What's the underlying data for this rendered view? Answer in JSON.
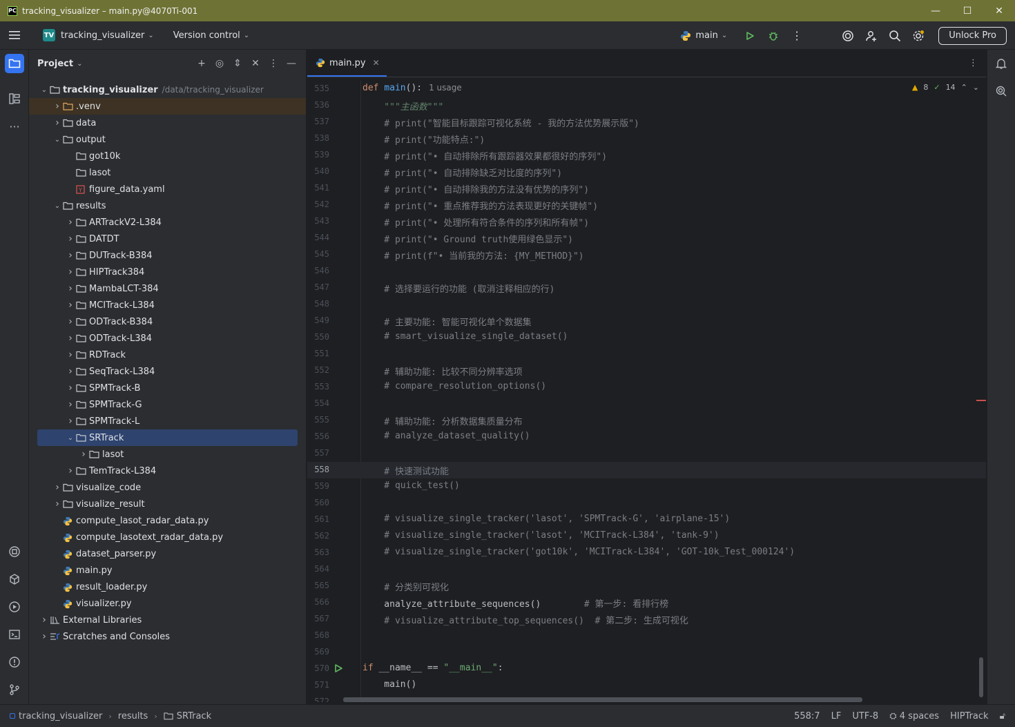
{
  "window": {
    "title": "tracking_visualizer – main.py@4070Ti-001",
    "minimize": "—",
    "maximize": "☐",
    "close": "✕"
  },
  "toolbar": {
    "project_badge": "TV",
    "project_name": "tracking_visualizer",
    "version_control": "Version control",
    "run_config": "main",
    "unlock": "Unlock Pro"
  },
  "project_panel": {
    "title": "Project",
    "tree": [
      {
        "label": "tracking_visualizer",
        "hint": "/data/tracking_visualizer",
        "level": 0,
        "type": "folder",
        "expanded": true,
        "bold": true
      },
      {
        "label": ".venv",
        "level": 1,
        "type": "folder-venv",
        "expanded": false
      },
      {
        "label": "data",
        "level": 1,
        "type": "folder",
        "expanded": false
      },
      {
        "label": "output",
        "level": 1,
        "type": "folder",
        "expanded": true
      },
      {
        "label": "got10k",
        "level": 2,
        "type": "folder",
        "leaf": true
      },
      {
        "label": "lasot",
        "level": 2,
        "type": "folder",
        "leaf": true
      },
      {
        "label": "figure_data.yaml",
        "level": 2,
        "type": "yaml",
        "leaf": true
      },
      {
        "label": "results",
        "level": 1,
        "type": "folder",
        "expanded": true
      },
      {
        "label": "ARTrackV2-L384",
        "level": 2,
        "type": "folder",
        "expanded": false
      },
      {
        "label": "DATDT",
        "level": 2,
        "type": "folder",
        "expanded": false
      },
      {
        "label": "DUTrack-B384",
        "level": 2,
        "type": "folder",
        "expanded": false
      },
      {
        "label": "HIPTrack384",
        "level": 2,
        "type": "folder",
        "expanded": false
      },
      {
        "label": "MambaLCT-384",
        "level": 2,
        "type": "folder",
        "expanded": false
      },
      {
        "label": "MCITrack-L384",
        "level": 2,
        "type": "folder",
        "expanded": false
      },
      {
        "label": "ODTrack-B384",
        "level": 2,
        "type": "folder",
        "expanded": false
      },
      {
        "label": "ODTrack-L384",
        "level": 2,
        "type": "folder",
        "expanded": false
      },
      {
        "label": "RDTrack",
        "level": 2,
        "type": "folder",
        "expanded": false
      },
      {
        "label": "SeqTrack-L384",
        "level": 2,
        "type": "folder",
        "expanded": false
      },
      {
        "label": "SPMTrack-B",
        "level": 2,
        "type": "folder",
        "expanded": false
      },
      {
        "label": "SPMTrack-G",
        "level": 2,
        "type": "folder",
        "expanded": false
      },
      {
        "label": "SPMTrack-L",
        "level": 2,
        "type": "folder",
        "expanded": false
      },
      {
        "label": "SRTrack",
        "level": 2,
        "type": "folder",
        "expanded": true,
        "selected": true
      },
      {
        "label": "lasot",
        "level": 3,
        "type": "folder",
        "expanded": false
      },
      {
        "label": "TemTrack-L384",
        "level": 2,
        "type": "folder",
        "expanded": false
      },
      {
        "label": "visualize_code",
        "level": 1,
        "type": "folder",
        "expanded": false
      },
      {
        "label": "visualize_result",
        "level": 1,
        "type": "folder",
        "expanded": false
      },
      {
        "label": "compute_lasot_radar_data.py",
        "level": 1,
        "type": "py",
        "leaf": true
      },
      {
        "label": "compute_lasotext_radar_data.py",
        "level": 1,
        "type": "py",
        "leaf": true
      },
      {
        "label": "dataset_parser.py",
        "level": 1,
        "type": "py",
        "leaf": true
      },
      {
        "label": "main.py",
        "level": 1,
        "type": "py",
        "leaf": true
      },
      {
        "label": "result_loader.py",
        "level": 1,
        "type": "py",
        "leaf": true
      },
      {
        "label": "visualizer.py",
        "level": 1,
        "type": "py",
        "leaf": true
      },
      {
        "label": "External Libraries",
        "level": 0,
        "type": "library",
        "expanded": false
      },
      {
        "label": "Scratches and Consoles",
        "level": 0,
        "type": "scratch",
        "expanded": false
      }
    ]
  },
  "editor": {
    "tab": "main.py",
    "inspections": {
      "warnings": "8",
      "ok": "14"
    },
    "current_line": "558",
    "lines": [
      {
        "n": "535",
        "segs": [
          [
            "kw",
            "def "
          ],
          [
            "fn",
            "main"
          ],
          [
            "plain",
            "():"
          ],
          [
            "hint",
            "1 usage"
          ]
        ]
      },
      {
        "n": "536",
        "segs": [
          [
            "doc",
            "    \"\"\"主函数\"\"\""
          ]
        ]
      },
      {
        "n": "537",
        "segs": [
          [
            "cm",
            "    # print(\"智能目标跟踪可视化系统 - 我的方法优势展示版\")"
          ]
        ]
      },
      {
        "n": "538",
        "segs": [
          [
            "cm",
            "    # print(\"功能特点:\")"
          ]
        ]
      },
      {
        "n": "539",
        "segs": [
          [
            "cm",
            "    # print(\"• 自动排除所有跟踪器效果都很好的序列\")"
          ]
        ]
      },
      {
        "n": "540",
        "segs": [
          [
            "cm",
            "    # print(\"• 自动排除缺乏对比度的序列\")"
          ]
        ]
      },
      {
        "n": "541",
        "segs": [
          [
            "cm",
            "    # print(\"• 自动排除我的方法没有优势的序列\")"
          ]
        ]
      },
      {
        "n": "542",
        "segs": [
          [
            "cm",
            "    # print(\"• 重点推荐我的方法表现更好的关键帧\")"
          ]
        ]
      },
      {
        "n": "543",
        "segs": [
          [
            "cm",
            "    # print(\"• 处理所有符合条件的序列和所有帧\")"
          ]
        ]
      },
      {
        "n": "544",
        "segs": [
          [
            "cm",
            "    # print(\"• Ground truth使用绿色显示\")"
          ]
        ]
      },
      {
        "n": "545",
        "segs": [
          [
            "cm",
            "    # print(f\"• 当前我的方法: {MY_METHOD}\")"
          ]
        ]
      },
      {
        "n": "546",
        "segs": []
      },
      {
        "n": "547",
        "segs": [
          [
            "cm",
            "    # 选择要运行的功能 (取消注释相应的行)"
          ]
        ]
      },
      {
        "n": "548",
        "segs": []
      },
      {
        "n": "549",
        "segs": [
          [
            "cm",
            "    # 主要功能: 智能可视化单个数据集"
          ]
        ]
      },
      {
        "n": "550",
        "segs": [
          [
            "cm",
            "    # smart_visualize_single_dataset()"
          ]
        ]
      },
      {
        "n": "551",
        "segs": []
      },
      {
        "n": "552",
        "segs": [
          [
            "cm",
            "    # 辅助功能: 比较不同分辨率选项"
          ]
        ]
      },
      {
        "n": "553",
        "segs": [
          [
            "cm",
            "    # compare_resolution_options()"
          ]
        ]
      },
      {
        "n": "554",
        "segs": []
      },
      {
        "n": "555",
        "segs": [
          [
            "cm",
            "    # 辅助功能: 分析数据集质量分布"
          ]
        ]
      },
      {
        "n": "556",
        "segs": [
          [
            "cm",
            "    # analyze_dataset_quality()"
          ]
        ]
      },
      {
        "n": "557",
        "segs": []
      },
      {
        "n": "558",
        "segs": [
          [
            "cm",
            "    # 快速测试功能"
          ]
        ]
      },
      {
        "n": "559",
        "segs": [
          [
            "cm",
            "    # quick_test()"
          ]
        ]
      },
      {
        "n": "560",
        "segs": []
      },
      {
        "n": "561",
        "segs": [
          [
            "cm",
            "    # visualize_single_tracker('lasot', 'SPMTrack-G', 'airplane-15')"
          ]
        ]
      },
      {
        "n": "562",
        "segs": [
          [
            "cm",
            "    # visualize_single_tracker('lasot', 'MCITrack-L384', 'tank-9')"
          ]
        ]
      },
      {
        "n": "563",
        "segs": [
          [
            "cm",
            "    # visualize_single_tracker('got10k', 'MCITrack-L384', 'GOT-10k_Test_000124')"
          ]
        ]
      },
      {
        "n": "564",
        "segs": []
      },
      {
        "n": "565",
        "segs": [
          [
            "cm",
            "    # 分类别可视化"
          ]
        ]
      },
      {
        "n": "566",
        "segs": [
          [
            "plain",
            "    analyze_attribute_sequences()        "
          ],
          [
            "cm",
            "# 第一步: 看排行榜"
          ]
        ]
      },
      {
        "n": "567",
        "segs": [
          [
            "cm",
            "    # visualize_attribute_top_sequences()  # 第二步: 生成可视化"
          ]
        ]
      },
      {
        "n": "568",
        "segs": []
      },
      {
        "n": "569",
        "segs": []
      },
      {
        "n": "570",
        "segs": [
          [
            "kw",
            "if "
          ],
          [
            "plain",
            "__name__ == "
          ],
          [
            "str",
            "\"__main__\""
          ],
          [
            "plain",
            ":"
          ]
        ],
        "run": true
      },
      {
        "n": "571",
        "segs": [
          [
            "plain",
            "    main()"
          ]
        ]
      },
      {
        "n": "572",
        "segs": []
      }
    ]
  },
  "statusbar": {
    "breadcrumbs": [
      "tracking_visualizer",
      "results",
      "SRTrack"
    ],
    "position": "558:7",
    "line_sep": "LF",
    "encoding": "UTF-8",
    "indent": "4 spaces",
    "interpreter": "HIPTrack"
  },
  "colors": {
    "accent": "#3574f0",
    "titlebar": "#6e7335",
    "selection": "#2e436e"
  }
}
